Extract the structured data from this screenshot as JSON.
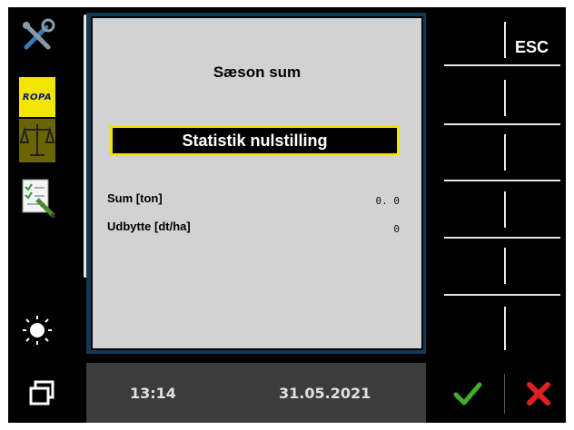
{
  "sidebar": {
    "icons": [
      "wrench-screwdriver-icon",
      "scale-icon",
      "checklist-icon",
      "sun-brightness-icon"
    ],
    "brand": "ROPA"
  },
  "panel": {
    "title": "Sæson sum",
    "reset_button": "Statistik nulstilling",
    "rows": [
      {
        "label": "Sum [ton]",
        "value": "0. 0"
      },
      {
        "label": "Udbytte [dt/ha]",
        "value": "0"
      }
    ]
  },
  "right": {
    "esc_label": "ESC"
  },
  "status": {
    "time": "13:14",
    "date": "31.05.2021"
  },
  "colors": {
    "highlight": "#f0e400",
    "confirm": "#3fae2a",
    "cancel": "#e02020"
  }
}
